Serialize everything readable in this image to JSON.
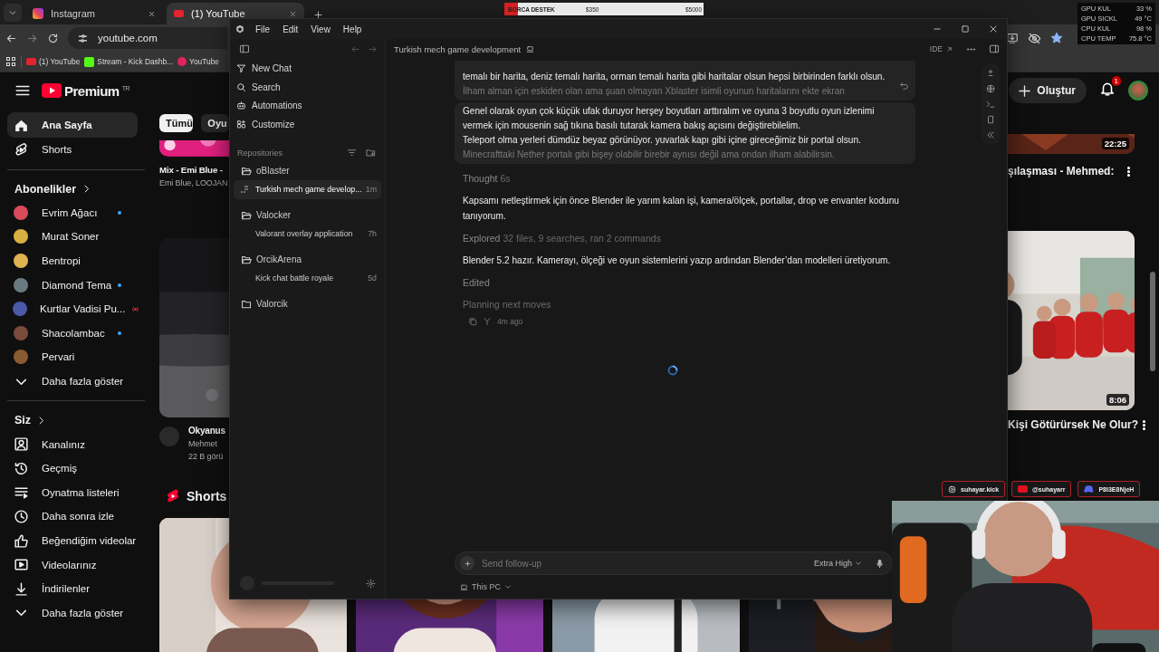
{
  "browser": {
    "tabs": [
      {
        "label": "Instagram",
        "selected": false
      },
      {
        "label": "(1) YouTube",
        "selected": true
      }
    ],
    "address": "youtube.com",
    "bookmarks": [
      {
        "label": "(1) YouTube"
      },
      {
        "label": "Stream - Kick Dashb..."
      },
      {
        "label": "YouTube"
      }
    ]
  },
  "youtube": {
    "logo": "Premium",
    "region": "TR",
    "create_button": "Oluştur",
    "notifications": "1",
    "nav": [
      {
        "label": "Ana Sayfa",
        "selected": true
      },
      {
        "label": "Shorts",
        "selected": false
      }
    ],
    "subscriptions": {
      "heading": "Abonelikler",
      "channels": [
        {
          "name": "Evrim Ağacı",
          "new_content": true,
          "live": false
        },
        {
          "name": "Murat Soner",
          "new_content": false,
          "live": false
        },
        {
          "name": "Bentropi",
          "new_content": false,
          "live": false
        },
        {
          "name": "Diamond Tema",
          "new_content": true,
          "live": false
        },
        {
          "name": "Kurtlar Vadisi Pu...",
          "new_content": false,
          "live": true
        },
        {
          "name": "Shacolambac",
          "new_content": true,
          "live": false
        },
        {
          "name": "Pervari",
          "new_content": false,
          "live": false
        }
      ],
      "more": "Daha fazla göster"
    },
    "you": {
      "heading": "Siz",
      "items": [
        "Kanalınız",
        "Geçmiş",
        "Oynatma listeleri",
        "Daha sonra izle",
        "Beğendiğim videolar",
        "Videolarınız",
        "İndirilenler"
      ],
      "more": "Daha fazla göster"
    },
    "chips": [
      {
        "label": "Tümü",
        "selected": true
      },
      {
        "label": "Oyu",
        "selected": false
      }
    ],
    "feed_left": [
      {
        "title": "Mix - Emi Blue -",
        "meta": [
          "Emi Blue, LOOJAN"
        ]
      },
      {
        "title": "Okyanus",
        "meta": [
          "Mehmet",
          "22 B görü"
        ]
      }
    ],
    "feed_right": [
      {
        "duration": "22:25",
        "title": "şılaşması - Mehmed:"
      },
      {
        "duration": "8:06",
        "title": "Kişi Götürürsek Ne Olur?"
      }
    ],
    "shorts_heading": "Shorts"
  },
  "donation_bar": {
    "label": "BORCA DESTEK",
    "current": "$350",
    "goal": "$5000",
    "level": 0.07
  },
  "system_stats": [
    {
      "label": "GPU KUL",
      "value": "33 %"
    },
    {
      "label": "GPU SICKL",
      "value": "49 °C"
    },
    {
      "label": "CPU KUL",
      "value": "98 %"
    },
    {
      "label": "CPU TEMP",
      "value": "75.8 °C"
    }
  ],
  "app": {
    "menu": [
      "File",
      "Edit",
      "View",
      "Help"
    ],
    "sidebar": {
      "actions": [
        "New Chat",
        "Search",
        "Automations",
        "Customize"
      ],
      "repositories_label": "Repositories",
      "repos": [
        {
          "name": "oBlaster",
          "expanded": true,
          "chats": [
            {
              "title": "Turkish mech game develop...",
              "time": "1m",
              "selected": true,
              "running": true
            }
          ]
        },
        {
          "name": "Valocker",
          "expanded": true,
          "chats": [
            {
              "title": "Valorant overlay application",
              "time": "7h",
              "selected": false,
              "running": false
            }
          ]
        },
        {
          "name": "OrcikArena",
          "expanded": true,
          "chats": [
            {
              "title": "Kick chat battle royale",
              "time": "5d",
              "selected": false,
              "running": false
            }
          ]
        },
        {
          "name": "Valorcik",
          "expanded": false
        }
      ]
    },
    "header": {
      "title": "Turkish mech game development",
      "ide": "IDE"
    },
    "messages": [
      {
        "kind": "user",
        "lines": [
          "temalı bir harita, deniz temalı harita, orman temalı harita gibi haritalar olsun hepsi birbirinden farklı olsun.",
          "İlham alman için eskiden olan ama şuan olmayan Xblaster isimli oyunun haritalarını ekte ekran"
        ]
      },
      {
        "kind": "user",
        "lines": [
          "Genel olarak oyun çok küçük ufak duruyor herşey boyutları arttıralım ve oyuna 3 boyutlu oyun izlenimi",
          "vermek için mousenin sağ tıkına basılı tutarak kamera bakış açısını değiştirebilelim.",
          "Teleport olma yerleri dümdüz beyaz görünüyor. yuvarlak kapı gibi içine gireceğimiz bir portal olsun.",
          "Minecrafttaki Nether portalı gibi bişey olabilir birebir aynısı değil ama ondan ilham alabilirsin."
        ]
      },
      {
        "kind": "status",
        "label": "Thought",
        "detail": "6s"
      },
      {
        "kind": "text",
        "text": "Kapsamı netleştirmek için önce Blender ile yarım kalan işi, kamera/ölçek, portallar, drop ve envanter kodunu tanıyorum."
      },
      {
        "kind": "status",
        "label": "Explored",
        "detail": "32 files, 9 searches, ran 2 commands"
      },
      {
        "kind": "text",
        "text": "Blender 5.2 hazır. Kamerayı, ölçeği ve oyun sistemlerini yazıp ardından Blender’dan modelleri üretiyorum."
      },
      {
        "kind": "status",
        "label": "Edited"
      },
      {
        "kind": "pending",
        "text": "Planning next moves"
      },
      {
        "kind": "meta",
        "time": "4m ago"
      }
    ],
    "composer": {
      "placeholder": "Send follow-up",
      "effort": "Extra High",
      "location": "This PC"
    }
  },
  "stream_overlay": {
    "socials": [
      {
        "handle": "suhayar.kick"
      },
      {
        "handle": "@suhayarr"
      },
      {
        "handle": "P8I3E8NjeH"
      }
    ]
  }
}
